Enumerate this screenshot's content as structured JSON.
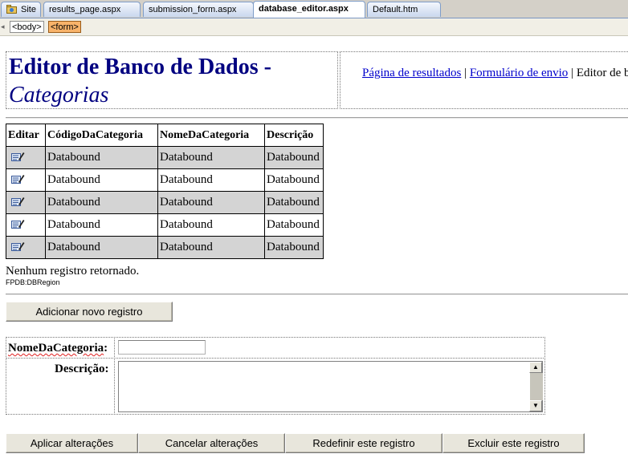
{
  "tabs": [
    {
      "label": "Site"
    },
    {
      "label": "results_page.aspx"
    },
    {
      "label": "submission_form.aspx"
    },
    {
      "label": "database_editor.aspx"
    },
    {
      "label": "Default.htm"
    }
  ],
  "tagbar": {
    "tags": [
      "<body>",
      "<form>"
    ]
  },
  "page": {
    "title_line1": "Editor de Banco de Dados -",
    "title_line2": "Categorias",
    "nav": {
      "link1": "Página de resultados",
      "sep1": " | ",
      "link2": "Formulário de envio",
      "sep2": " | ",
      "current": "Editor de banco de dados"
    }
  },
  "grid": {
    "headers": [
      "Editar",
      "CódigoDaCategoria",
      "NomeDaCategoria",
      "Descrição"
    ],
    "rows": [
      [
        "Databound",
        "Databound",
        "Databound"
      ],
      [
        "Databound",
        "Databound",
        "Databound"
      ],
      [
        "Databound",
        "Databound",
        "Databound"
      ],
      [
        "Databound",
        "Databound",
        "Databound"
      ],
      [
        "Databound",
        "Databound",
        "Databound"
      ]
    ],
    "empty_message": "Nenhum registro retornado.",
    "region_label": "FPDB:DBRegion"
  },
  "add_button": "Adicionar novo registro",
  "form": {
    "label_name": "NomeDaCategoria",
    "label_name_colon": ":",
    "label_desc": "Descrição:",
    "name_value": "",
    "desc_value": ""
  },
  "actions": {
    "apply": "Aplicar alterações",
    "cancel": "Cancelar alterações",
    "reset": "Redefinir este registro",
    "delete": "Excluir este registro"
  },
  "icons": {
    "site": "site-folder-icon",
    "edit": "edit-record-icon",
    "scroll_up": "scroll-up-icon",
    "scroll_down": "scroll-down-icon"
  },
  "colors": {
    "title": "#000080",
    "link": "#0000cc",
    "selected_tag": "#f8b36a",
    "row_alt": "#d4d4d4"
  }
}
